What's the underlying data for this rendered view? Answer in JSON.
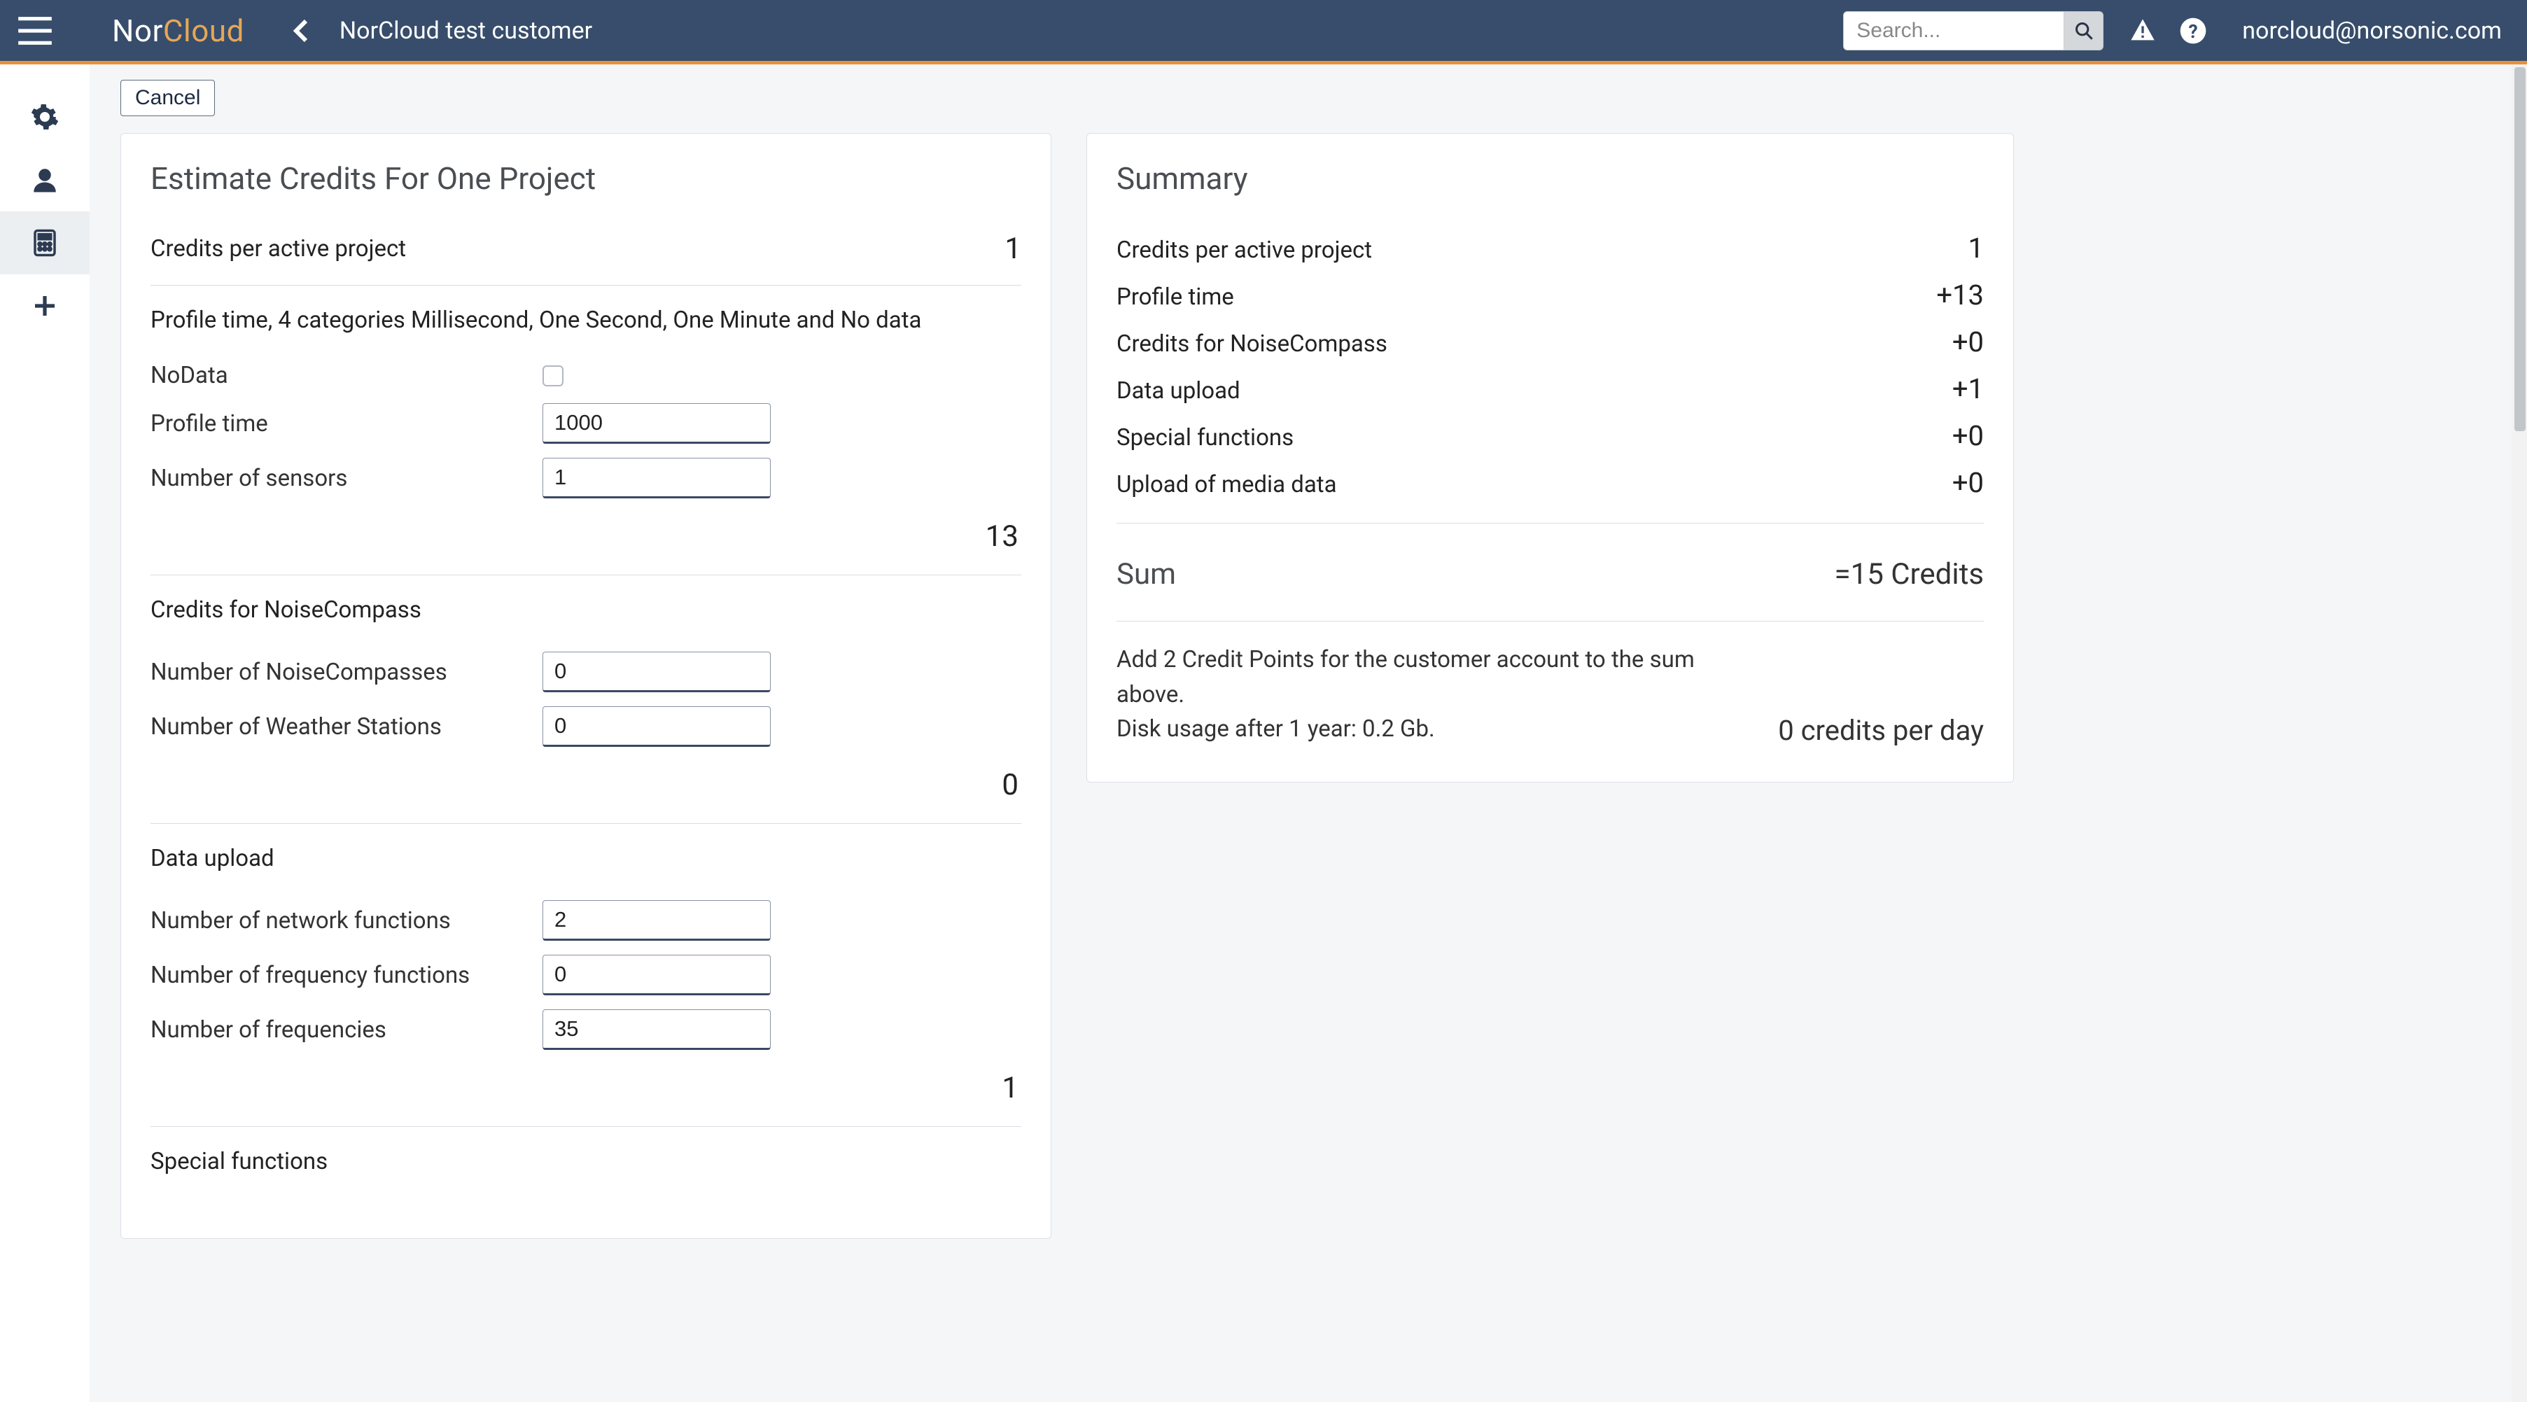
{
  "brand": {
    "nor": "Nor",
    "cloud": "Cloud"
  },
  "header": {
    "customer": "NorCloud test customer",
    "search_placeholder": "Search...",
    "user_email": "norcloud@norsonic.com"
  },
  "actions": {
    "cancel": "Cancel"
  },
  "estimate": {
    "title": "Estimate Credits For One Project",
    "credits_per_active_project": {
      "label": "Credits per active project",
      "value": "1"
    },
    "profile_desc": "Profile time, 4 categories Millisecond, One Second, One Minute and No data",
    "nodata_label": "NoData",
    "profile_time": {
      "label": "Profile time",
      "value": "1000"
    },
    "number_sensors": {
      "label": "Number of sensors",
      "value": "1"
    },
    "profile_subtotal": "13",
    "noisecompass_header": "Credits for NoiseCompass",
    "num_noisecompasses": {
      "label": "Number of NoiseCompasses",
      "value": "0"
    },
    "num_weather": {
      "label": "Number of Weather Stations",
      "value": "0"
    },
    "noisecompass_subtotal": "0",
    "dataupload_header": "Data upload",
    "num_network_fn": {
      "label": "Number of network functions",
      "value": "2"
    },
    "num_freq_fn": {
      "label": "Number of frequency functions",
      "value": "0"
    },
    "num_freq": {
      "label": "Number of frequencies",
      "value": "35"
    },
    "dataupload_subtotal": "1",
    "special_header": "Special functions"
  },
  "summary": {
    "title": "Summary",
    "rows": [
      {
        "label": "Credits per active project",
        "value": "1"
      },
      {
        "label": "Profile time",
        "value": "+13"
      },
      {
        "label": "Credits for NoiseCompass",
        "value": "+0"
      },
      {
        "label": "Data upload",
        "value": "+1"
      },
      {
        "label": "Special functions",
        "value": "+0"
      },
      {
        "label": "Upload of media data",
        "value": "+0"
      }
    ],
    "sum_label": "Sum",
    "sum_value": "=15 Credits",
    "note_line1": "Add 2 Credit Points for the customer account to the sum above.",
    "note_line2": "Disk usage after 1 year: 0.2 Gb.",
    "per_day": "0 credits per day"
  }
}
